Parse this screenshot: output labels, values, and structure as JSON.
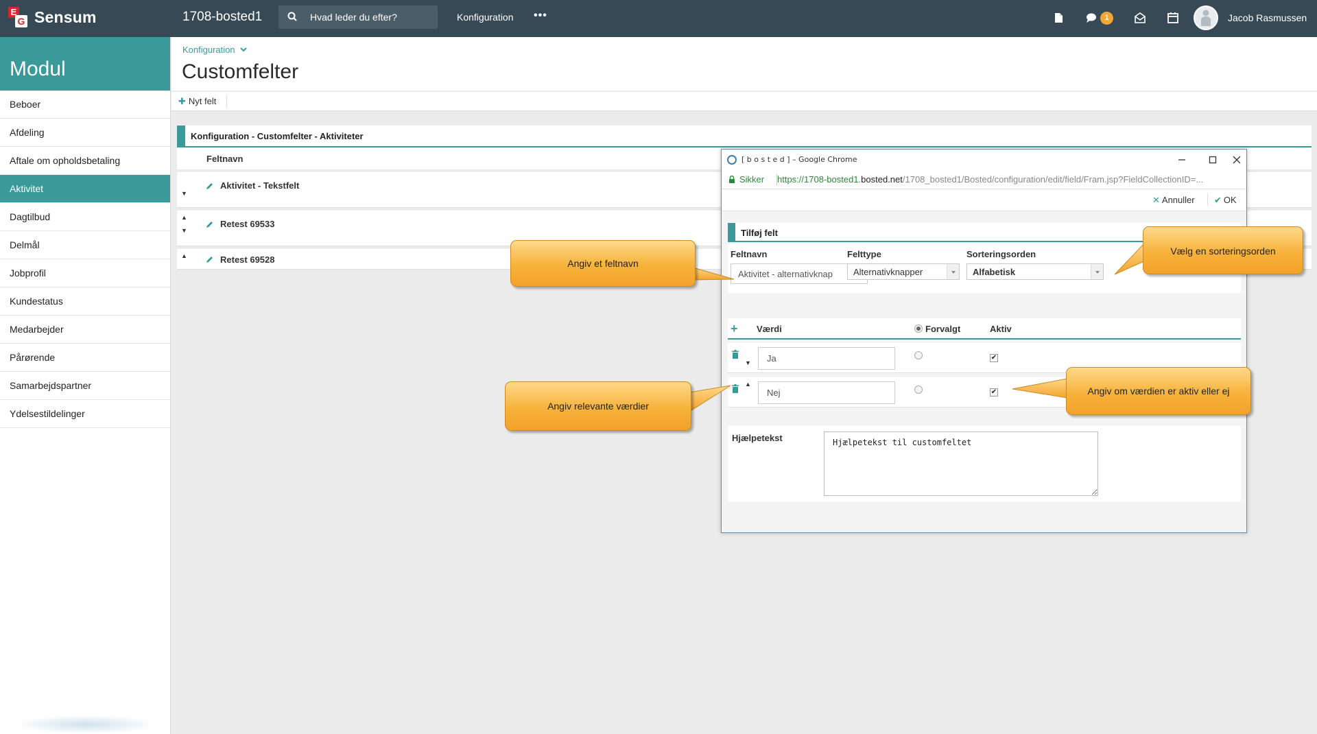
{
  "topbar": {
    "logo_text": "Sensum",
    "logo_mark_e": "E",
    "logo_mark_g": "G",
    "site_name": "1708-bosted1",
    "search_placeholder": "Hvad leder du efter?",
    "nav_configuration": "Konfiguration",
    "more": "•••",
    "chat_badge": "1",
    "user_name": "Jacob Rasmussen",
    "icons": [
      "search-icon",
      "document-icon",
      "chat-icon",
      "mail-icon",
      "calendar-icon",
      "user-avatar"
    ]
  },
  "sidebar": {
    "title": "Modul",
    "items": [
      {
        "label": "Beboer",
        "active": false
      },
      {
        "label": "Afdeling",
        "active": false
      },
      {
        "label": "Aftale om opholdsbetaling",
        "active": false
      },
      {
        "label": "Aktivitet",
        "active": true
      },
      {
        "label": "Dagtilbud",
        "active": false
      },
      {
        "label": "Delmål",
        "active": false
      },
      {
        "label": "Jobprofil",
        "active": false
      },
      {
        "label": "Kundestatus",
        "active": false
      },
      {
        "label": "Medarbejder",
        "active": false
      },
      {
        "label": "Pårørende",
        "active": false
      },
      {
        "label": "Samarbejdspartner",
        "active": false
      },
      {
        "label": "Ydelsestildelinger",
        "active": false
      }
    ]
  },
  "main": {
    "breadcrumb": "Konfiguration",
    "title": "Customfelter",
    "new_field": "Nyt felt",
    "panel_title": "Konfiguration - Customfelter - Aktiviteter",
    "column_header": "Feltnavn",
    "rows": [
      {
        "label": "Aktivitet - Tekstfelt"
      },
      {
        "label": "Retest 69533"
      },
      {
        "label": "Retest 69528"
      }
    ]
  },
  "popup": {
    "window_title": "[ b o s t e d ] – Google Chrome",
    "secure_label": "Sikker",
    "url_scheme_host": "https://1708-bosted1.",
    "url_domain": "bosted.net",
    "url_path": "/1708_bosted1/Bosted/configuration/edit/field/Fram.jsp?FieldCollectionID=...",
    "cancel_label": "Annuller",
    "ok_label": "OK",
    "section_title": "Tilføj felt",
    "labels": {
      "feltnavn": "Feltnavn",
      "felttype": "Felttype",
      "sortering": "Sorteringsorden",
      "vaerdi": "Værdi",
      "forvalgt": "Forvalgt",
      "aktiv": "Aktiv",
      "hjaelpetekst": "Hjælpetekst"
    },
    "feltnavn_value": "Aktivitet - alternativknap",
    "felttype_value": "Alternativknapper",
    "sortering_value": "Alfabetisk",
    "values": [
      {
        "value": "Ja",
        "default": false,
        "active": true
      },
      {
        "value": "Nej",
        "default": false,
        "active": true
      }
    ],
    "help_text": "Hjælpetekst til customfeltet"
  },
  "callouts": {
    "feltnavn": "Angiv et feltnavn",
    "sortering": "Vælg en sorteringsorden",
    "vaerdier": "Angiv relevante værdier",
    "aktiv": "Angiv om værdien er aktiv eller ej"
  },
  "colors": {
    "topbar": "#364954",
    "accent": "#3a9a9a",
    "callout": "#f7b23b",
    "badge": "#f2a634"
  }
}
